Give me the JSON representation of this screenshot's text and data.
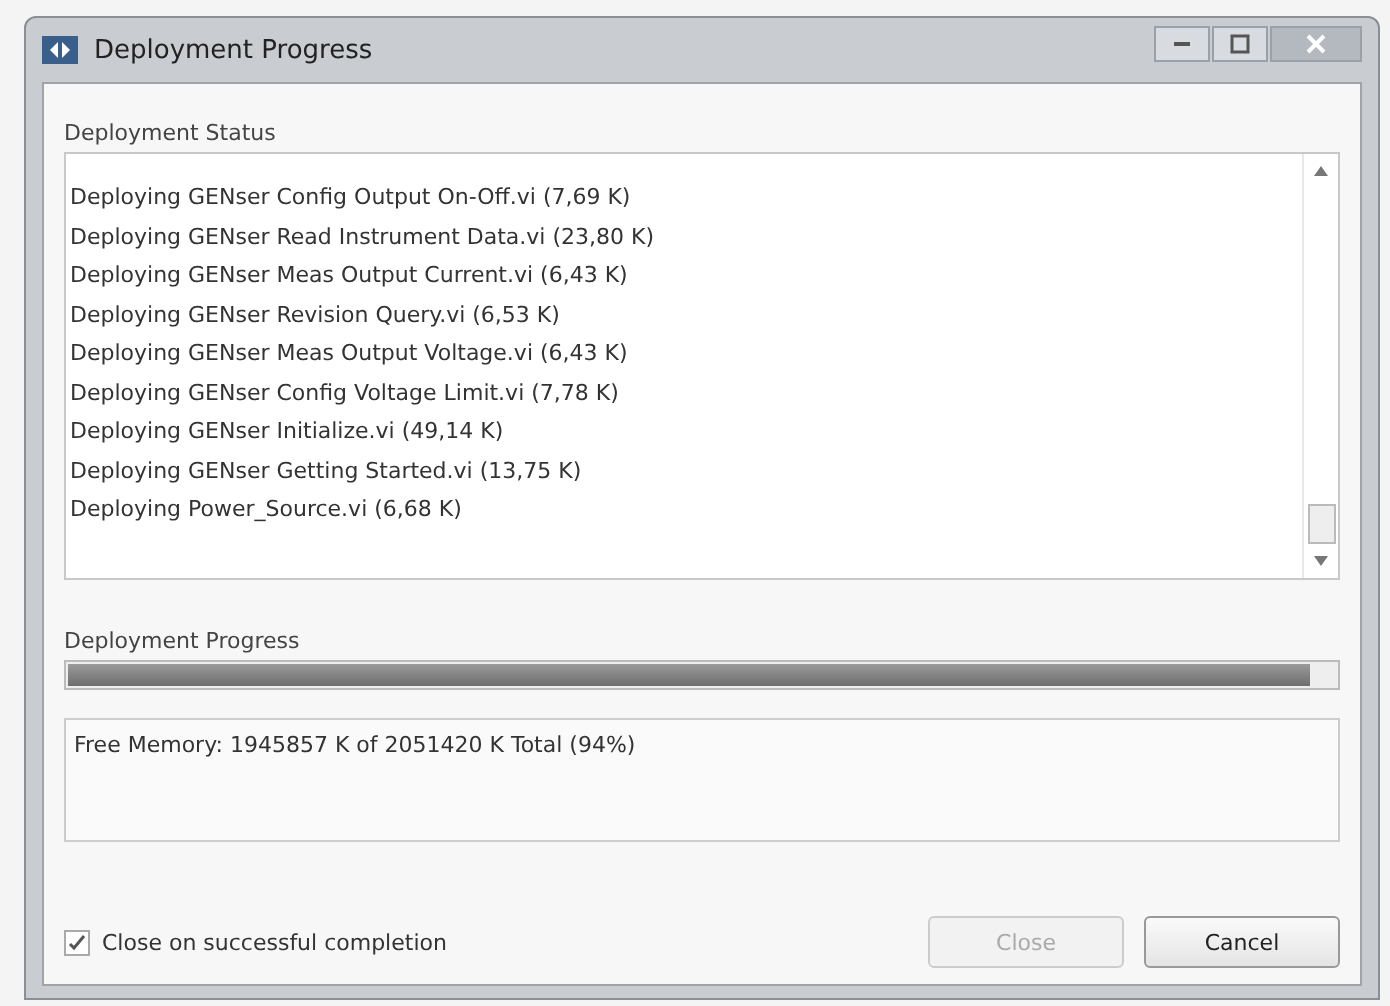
{
  "window": {
    "title": "Deployment Progress"
  },
  "status": {
    "label": "Deployment Status",
    "lines": [
      "Deploying GENser Config Output On-Off.vi (7,69 K)",
      "Deploying GENser Read Instrument Data.vi (23,80 K)",
      "Deploying GENser Meas Output Current.vi (6,43 K)",
      "Deploying GENser Revision Query.vi (6,53 K)",
      "Deploying GENser Meas Output Voltage.vi (6,43 K)",
      "Deploying GENser Config Voltage Limit.vi (7,78 K)",
      "Deploying GENser Initialize.vi (49,14 K)",
      "Deploying GENser Getting Started.vi (13,75 K)",
      "Deploying Power_Source.vi (6,68 K)"
    ]
  },
  "progress": {
    "label": "Deployment Progress",
    "level": 0.98
  },
  "memory": {
    "text": "Free Memory: 1945857 K of 2051420 K Total (94%)"
  },
  "close_on_completion": {
    "label": "Close on successful completion",
    "checked": true
  },
  "buttons": [
    {
      "label": "Close",
      "disabled": true
    },
    {
      "label": "Cancel",
      "disabled": false
    }
  ]
}
